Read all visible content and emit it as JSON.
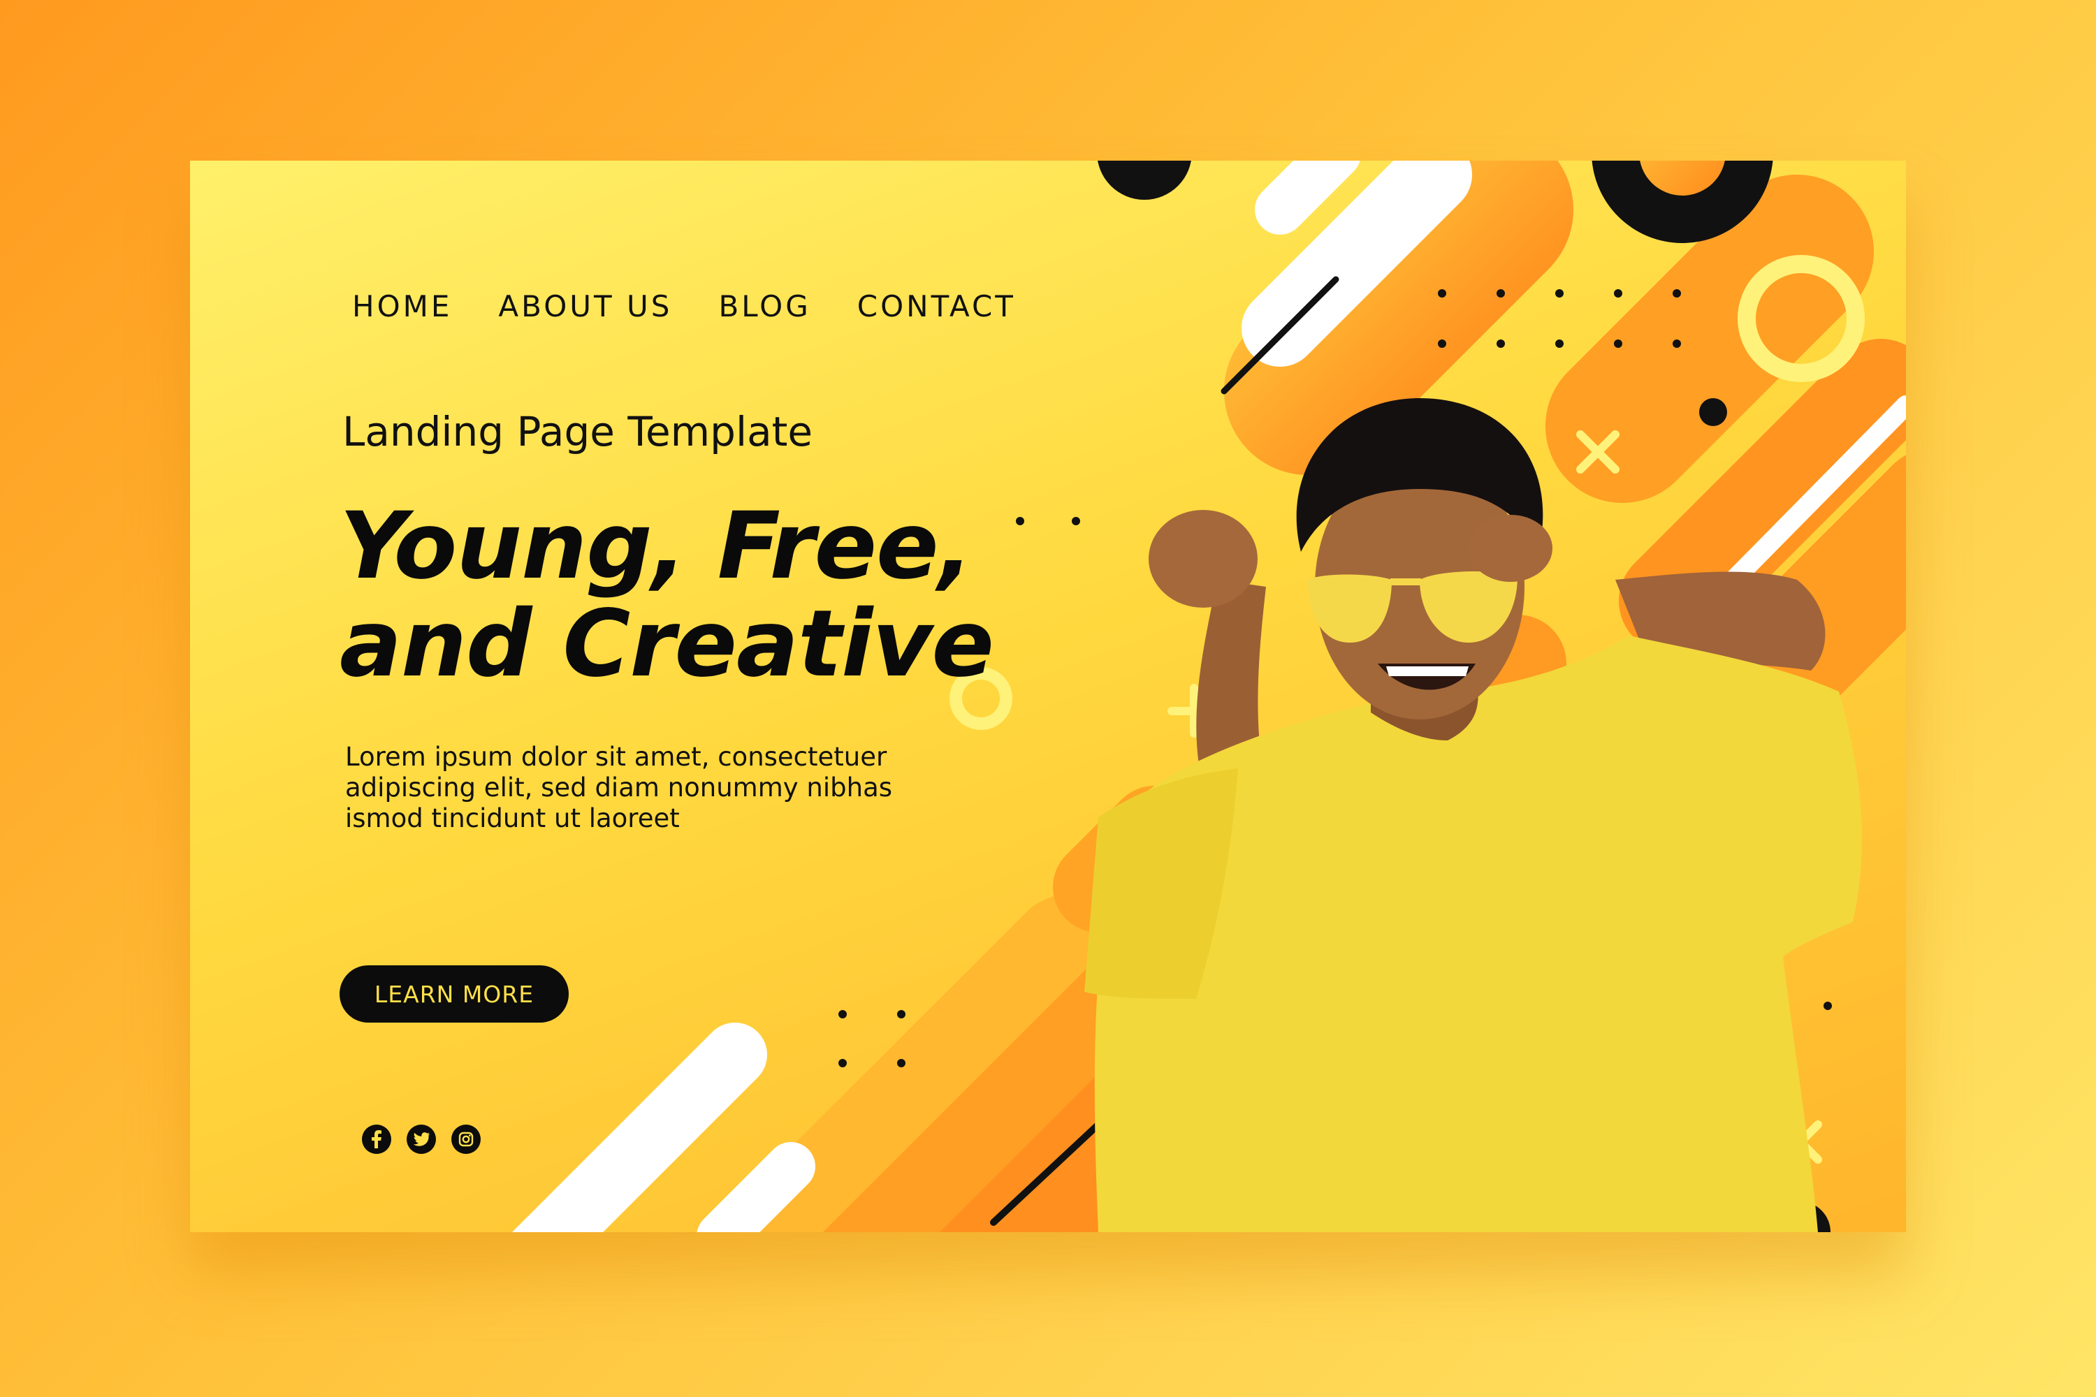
{
  "nav": {
    "items": [
      {
        "label": "HOME"
      },
      {
        "label": "ABOUT US"
      },
      {
        "label": "BLOG"
      },
      {
        "label": "CONTACT"
      }
    ]
  },
  "hero": {
    "kicker": "Landing Page Template",
    "headline_line1": "Young, Free,",
    "headline_line2": "and Creative",
    "body": "Lorem ipsum dolor sit amet, consectetuer adipiscing elit, sed diam nonummy nibhas ismod tincidunt ut laoreet",
    "cta_label": "LEARN MORE"
  },
  "social": {
    "icons": [
      "facebook-icon",
      "twitter-icon",
      "instagram-icon"
    ]
  },
  "colors": {
    "background": "#ffb52c",
    "card_yellow": "#ffe04a",
    "accent_orange": "#ff9320",
    "text": "#0a0a0a",
    "button_bg": "#0c0c0c",
    "button_text": "#ffe04a"
  }
}
